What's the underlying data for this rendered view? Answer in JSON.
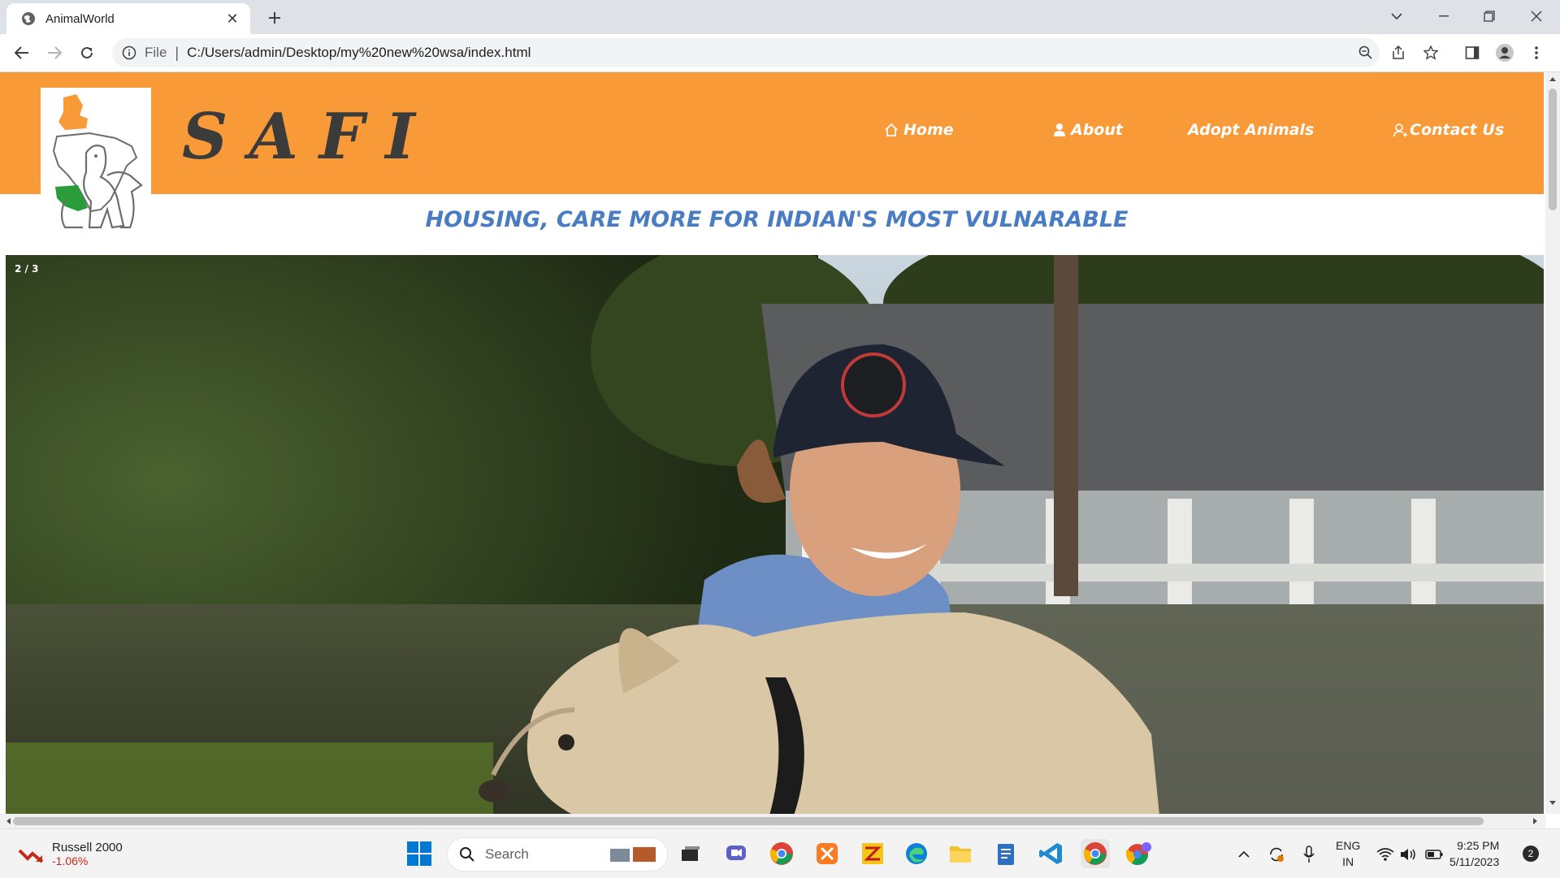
{
  "browser": {
    "tab_title": "AnimalWorld",
    "omnibox_scheme_label": "File",
    "url": "C:/Users/admin/Desktop/my%20new%20wsa/index.html"
  },
  "site": {
    "brand": "SAFI",
    "nav": [
      {
        "label": "Home",
        "icon": "home-icon"
      },
      {
        "label": "About",
        "icon": "person-icon"
      },
      {
        "label": "Adopt Animals",
        "icon": ""
      },
      {
        "label": "Contact Us",
        "icon": "contact-icon"
      }
    ],
    "tagline": "HOUSING, CARE MORE FOR INDIAN'S MOST VULNARABLE",
    "slide_counter": "2 / 3",
    "colors": {
      "header": "#f89a38",
      "tagline": "#4a7cc4",
      "brand": "#3b3b3b"
    }
  },
  "taskbar": {
    "ticker_name": "Russell 2000",
    "ticker_change": "-1.06%",
    "search_placeholder": "Search",
    "lang_line1": "ENG",
    "lang_line2": "IN",
    "time": "9:25 PM",
    "date": "5/11/2023",
    "notifications": "2"
  }
}
